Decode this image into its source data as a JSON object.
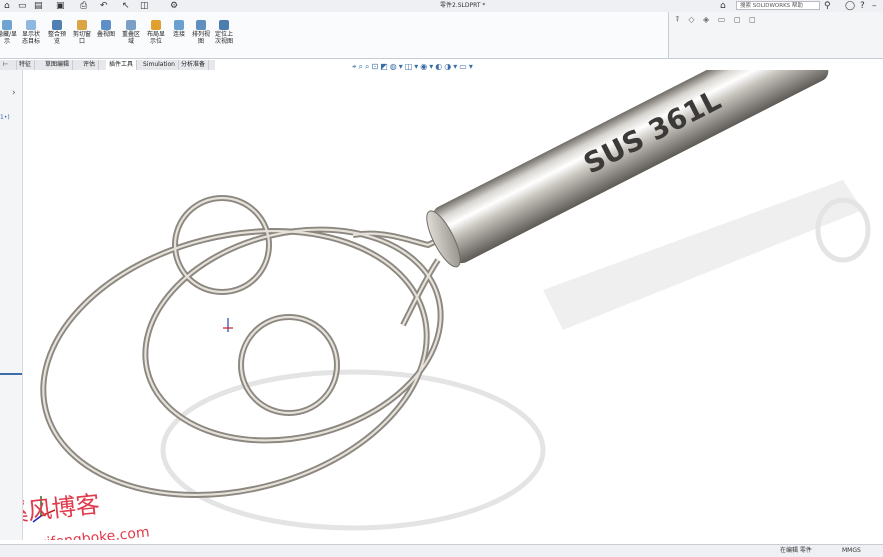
{
  "window": {
    "title": "零件2.SLDPRT *"
  },
  "search": {
    "placeholder": "搜索 SOLIDWORKS 帮助"
  },
  "ribbon": {
    "buttons": [
      {
        "label": "隐藏/显示"
      },
      {
        "label": "显示状态目标"
      },
      {
        "label": "整合预览"
      },
      {
        "label": "剪切窗口"
      },
      {
        "label": "叠视图"
      },
      {
        "label": "重叠区域"
      },
      {
        "label": "布局显示位"
      },
      {
        "label": "连接"
      },
      {
        "label": "排列视图"
      },
      {
        "label": "定位上次视图"
      }
    ]
  },
  "tabs": [
    "⊢",
    "特征",
    "草图编辑",
    "评估",
    "插件工具",
    "Simulation",
    "分析准备"
  ],
  "active_tab": "插件工具",
  "model": {
    "engraving": "SUS 361L"
  },
  "watermark": {
    "name": "溪风博客",
    "url": "xifengboke.com"
  },
  "status": {
    "editing": "在编辑 零件",
    "units": "MMGS"
  },
  "colors": {
    "accent": "#3a6ea5",
    "metal": "#b8b4ae"
  }
}
